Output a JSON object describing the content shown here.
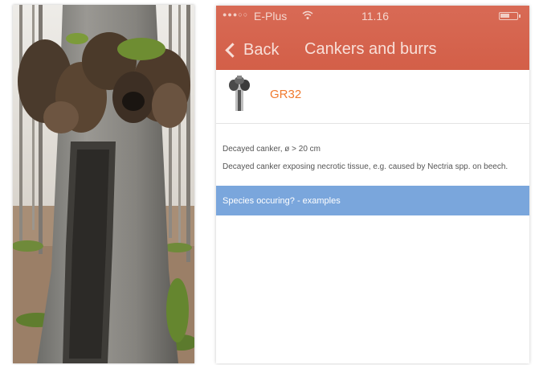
{
  "status_bar": {
    "signal": "●●●○○",
    "carrier": "E-Plus",
    "time": "11.16"
  },
  "nav": {
    "back_label": "Back",
    "title": "Cankers and burrs"
  },
  "item": {
    "code": "GR32"
  },
  "description": {
    "short": "Decayed canker, ø > 20 cm",
    "long": "Decayed canker exposing necrotic tissue, e.g. caused by Nectria spp. on beech."
  },
  "species_link": "Species occuring? - examples",
  "icons": {
    "wifi": "wifi-icon",
    "battery": "battery-icon",
    "back": "chevron-left-icon"
  },
  "colors": {
    "header": "#d35f48",
    "accent_code": "#f07a2e",
    "species_bar": "#7aa6dc"
  }
}
